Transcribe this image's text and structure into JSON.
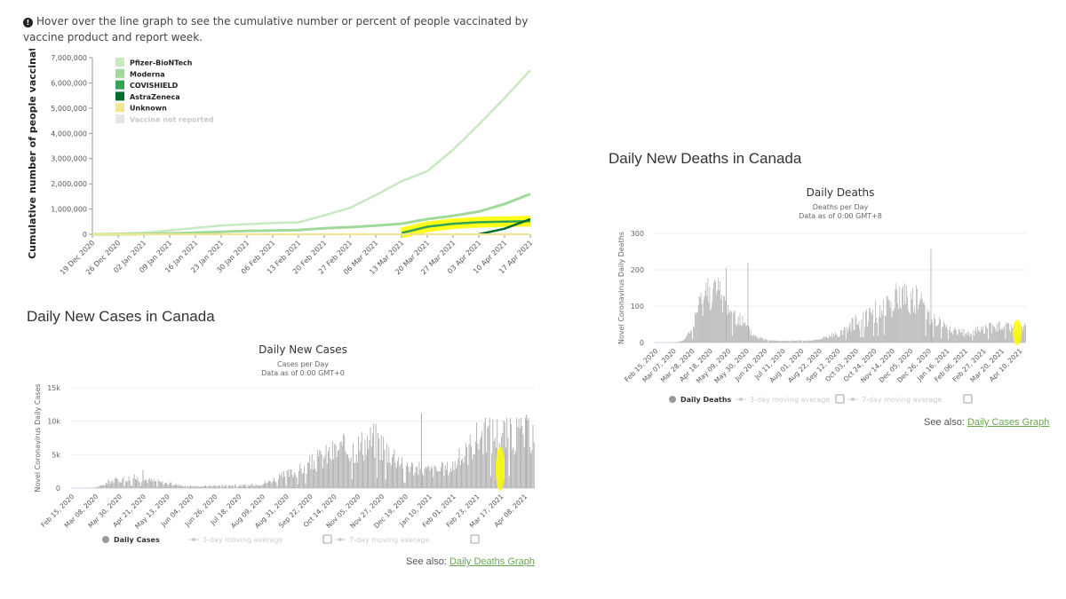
{
  "hint": {
    "icon": "info-circle-icon",
    "text": "Hover over the line graph to see the cumulative number or percent of people vaccinated by vaccine product and report week."
  },
  "vaccine_chart": {
    "chart_data": {
      "type": "line",
      "title": "",
      "ylabel": "Cumulative number of people vaccinated",
      "xlabel": "",
      "ylim": [
        0,
        7000000
      ],
      "yticks": [
        "0",
        "1,000,000",
        "2,000,000",
        "3,000,000",
        "4,000,000",
        "5,000,000",
        "6,000,000",
        "7,000,000"
      ],
      "ytick_values": [
        0,
        1000000,
        2000000,
        3000000,
        4000000,
        5000000,
        6000000,
        7000000
      ],
      "categories": [
        "19 Dec 2020",
        "26 Dec 2020",
        "02 Jan 2021",
        "09 Jan 2021",
        "16 Jan 2021",
        "23 Jan 2021",
        "30 Jan 2021",
        "06 Feb 2021",
        "13 Feb 2021",
        "20 Feb 2021",
        "27 Feb 2021",
        "06 Mar 2021",
        "13 Mar 2021",
        "20 Mar 2021",
        "27 Mar 2021",
        "03 Apr 2021",
        "10 Apr 2021",
        "17 Apr 2021"
      ],
      "series": [
        {
          "name": "Pfizer-BioNTech",
          "color": "#c7e9c0",
          "values": [
            0,
            20000,
            60000,
            150000,
            250000,
            350000,
            400000,
            450000,
            470000,
            750000,
            1050000,
            1550000,
            2100000,
            2500000,
            3350000,
            4350000,
            5400000,
            6500000
          ]
        },
        {
          "name": "Moderna",
          "color": "#a1d99b",
          "values": [
            0,
            0,
            10000,
            30000,
            60000,
            100000,
            130000,
            150000,
            170000,
            240000,
            280000,
            340000,
            420000,
            600000,
            730000,
            900000,
            1200000,
            1600000
          ]
        },
        {
          "name": "COVISHIELD",
          "color": "#31a354",
          "values": [
            null,
            null,
            null,
            null,
            null,
            null,
            null,
            null,
            null,
            null,
            null,
            null,
            50000,
            300000,
            420000,
            480000,
            500000,
            520000
          ]
        },
        {
          "name": "AstraZeneca",
          "color": "#006d2c",
          "values": [
            null,
            null,
            null,
            null,
            null,
            null,
            null,
            null,
            null,
            null,
            null,
            null,
            null,
            null,
            null,
            0,
            220000,
            600000
          ]
        },
        {
          "name": "Unknown",
          "color": "#f0e68c",
          "values": [
            0,
            0,
            0,
            0,
            0,
            0,
            0,
            0,
            0,
            0,
            0,
            0,
            0,
            0,
            0,
            0,
            0,
            0
          ]
        },
        {
          "name": "Vaccine not reported",
          "color": "#e5e5e5",
          "values": []
        }
      ],
      "legend": "top-left",
      "highlight": {
        "series": "COVISHIELD",
        "color": "#ffff00"
      }
    }
  },
  "cases_section": {
    "heading": "Daily New Cases in Canada",
    "chart_data": {
      "type": "bar",
      "title": "Daily New Cases",
      "subtitle_line1": "Cases per Day",
      "subtitle_line2": "Data as of 0:00 GMT+0",
      "ylabel": "Novel Coronavirus Daily Cases",
      "ylim": [
        0,
        15000
      ],
      "yticks": [
        "0",
        "5k",
        "10k",
        "15k"
      ],
      "ytick_values": [
        0,
        5000,
        10000,
        15000
      ],
      "grid": true,
      "xticks": [
        "Feb 15, 2020",
        "Mar 08, 2020",
        "Mar 30, 2020",
        "Apr 21, 2020",
        "May 13, 2020",
        "Jun 04, 2020",
        "Jun 26, 2020",
        "Jul 18, 2020",
        "Aug 09, 2020",
        "Aug 31, 2020",
        "Sep 22, 2020",
        "Oct 14, 2020",
        "Nov 05, 2020",
        "Nov 27, 2020",
        "Dec 19, 2020",
        "Jan 10, 2021",
        "Feb 01, 2021",
        "Feb 23, 2021",
        "Mar 17, 2021",
        "Apr 08, 2021"
      ],
      "weekly_profile": [
        0,
        0,
        0,
        50,
        400,
        1100,
        1300,
        1500,
        1700,
        1500,
        1300,
        1100,
        900,
        700,
        500,
        400,
        300,
        300,
        350,
        400,
        450,
        450,
        400,
        450,
        500,
        700,
        1000,
        1500,
        2000,
        2400,
        2800,
        3500,
        4200,
        4800,
        5500,
        6000,
        6300,
        6500,
        6800,
        7500,
        7800,
        7000,
        5800,
        5000,
        4200,
        3300,
        3000,
        2900,
        2800,
        3000,
        3300,
        4500,
        5600,
        7500,
        8500,
        8800
      ],
      "peaks": [
        {
          "date": "Apr 21, 2020",
          "value": 2700
        },
        {
          "date": "Jan 03, 2021",
          "value": 11200
        },
        {
          "date": "Apr 10, 2021",
          "value": 11000
        }
      ],
      "highlight": {
        "date": "Mar 17, 2021",
        "color": "#ffff00"
      },
      "legend": [
        "Daily Cases",
        "3-day moving average",
        "7-day moving average"
      ]
    },
    "legend": {
      "daily": "Daily Cases",
      "ma3": "3-day moving average",
      "ma7": "7-day moving average"
    },
    "see_also_label": "See also:",
    "see_also_link": "Daily Deaths Graph"
  },
  "deaths_section": {
    "heading": "Daily New Deaths in Canada",
    "chart_data": {
      "type": "bar",
      "title": "Daily Deaths",
      "subtitle_line1": "Deaths per Day",
      "subtitle_line2": "Data as of 0:00 GMT+8",
      "ylabel": "Novel Coronavirus Daily Deaths",
      "ylim": [
        0,
        300
      ],
      "yticks": [
        "0",
        "100",
        "200",
        "300"
      ],
      "ytick_values": [
        0,
        100,
        200,
        300
      ],
      "grid": true,
      "xticks": [
        "Feb 15, 2020",
        "Mar 07, 2020",
        "Mar 28, 2020",
        "Apr 18, 2020",
        "May 09, 2020",
        "May 30, 2020",
        "Jun 20, 2020",
        "Jul 11, 2020",
        "Aug 01, 2020",
        "Aug 22, 2020",
        "Sep 12, 2020",
        "Oct 03, 2020",
        "Oct 24, 2020",
        "Nov 14, 2020",
        "Dec 05, 2020",
        "Dec 26, 2020",
        "Jan 16, 2021",
        "Feb 06, 2021",
        "Feb 27, 2021",
        "Mar 20, 2021",
        "Apr 10, 2021"
      ],
      "weekly_profile": [
        0,
        0,
        0,
        0,
        2,
        10,
        40,
        90,
        140,
        160,
        150,
        130,
        110,
        90,
        70,
        45,
        25,
        15,
        10,
        8,
        6,
        5,
        5,
        5,
        5,
        5,
        6,
        8,
        15,
        20,
        25,
        35,
        50,
        60,
        70,
        80,
        90,
        100,
        110,
        120,
        130,
        140,
        135,
        125,
        110,
        90,
        70,
        55,
        45,
        35,
        30,
        28,
        30,
        35,
        40,
        45
      ],
      "peaks": [
        {
          "date": "May 07, 2020",
          "value": 205
        },
        {
          "date": "Jun 01, 2020",
          "value": 220
        },
        {
          "date": "Dec 29, 2020",
          "value": 257
        }
      ],
      "highlight": {
        "date": "Apr 10, 2021",
        "color": "#ffff00"
      },
      "legend": [
        "Daily Deaths",
        "3-day moving average",
        "7-day moving average"
      ]
    },
    "legend": {
      "daily": "Daily Deaths",
      "ma3": "3-day moving average",
      "ma7": "7-day moving average"
    },
    "see_also_label": "See also:",
    "see_also_link": "Daily Cases Graph"
  }
}
